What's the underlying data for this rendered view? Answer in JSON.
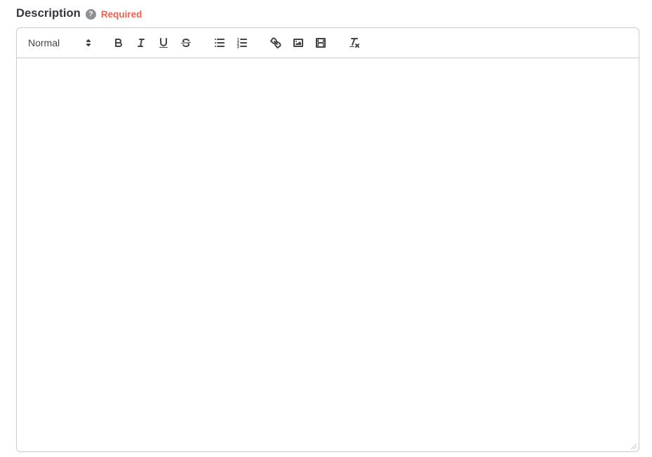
{
  "field": {
    "label": "Description",
    "help_glyph": "?",
    "required_badge": "Required"
  },
  "editor": {
    "toolbar": {
      "header_picker": {
        "selected": "Normal"
      },
      "groups": [
        {
          "buttons": [
            "header-format-picker"
          ]
        },
        {
          "buttons": [
            "bold",
            "italic",
            "underline",
            "strikethrough"
          ]
        },
        {
          "buttons": [
            "bullet-list",
            "ordered-list"
          ]
        },
        {
          "buttons": [
            "insert-link",
            "insert-image",
            "insert-video"
          ]
        },
        {
          "buttons": [
            "clean-formatting"
          ]
        }
      ]
    },
    "content": ""
  },
  "icons": {
    "help": "question-mark-circle",
    "picker_arrows": "up-down-triangles",
    "clean_formatting": "Tx",
    "resize": "diagonal-grip"
  },
  "colors": {
    "label_text": "#33373b",
    "required_text": "#f0604e",
    "help_icon_bg": "#8d9196",
    "toolbar_icon": "#444444",
    "border": "#cccccc",
    "background": "#ffffff"
  }
}
